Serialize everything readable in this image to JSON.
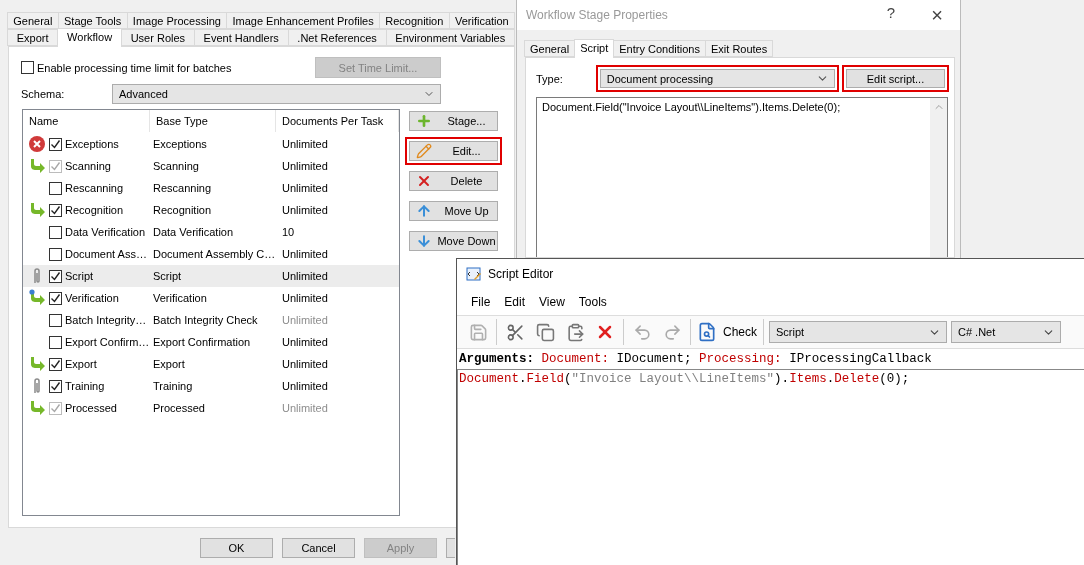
{
  "main_dialog": {
    "tabs": [
      [
        {
          "label": "General",
          "selected": false
        },
        {
          "label": "Stage Tools",
          "selected": false
        },
        {
          "label": "Image Processing",
          "selected": false
        },
        {
          "label": "Image Enhancement Profiles",
          "selected": false
        },
        {
          "label": "Recognition",
          "selected": false
        },
        {
          "label": "Verification",
          "selected": false
        }
      ],
      [
        {
          "label": "Export",
          "selected": false
        },
        {
          "label": "Workflow",
          "selected": true
        },
        {
          "label": "User Roles",
          "selected": false
        },
        {
          "label": "Event Handlers",
          "selected": false
        },
        {
          "label": ".Net References",
          "selected": false
        },
        {
          "label": "Environment Variables",
          "selected": false
        }
      ]
    ],
    "time_limit": {
      "label": "Enable processing time limit for batches",
      "checked": false
    },
    "set_time_limit": {
      "label": "Set Time Limit...",
      "disabled": true
    },
    "schema": {
      "label": "Schema:",
      "value": "Advanced"
    },
    "columns": [
      "Name",
      "Base Type",
      "Documents Per Task"
    ],
    "stages": [
      {
        "kind": "error",
        "name": "Exceptions",
        "base_type": "Exceptions",
        "docs": "Unlimited",
        "checked": true,
        "check_disabled": false,
        "docs_disabled": false,
        "selected": false
      },
      {
        "kind": "route",
        "name": "Scanning",
        "base_type": "Scanning",
        "docs": "Unlimited",
        "checked": true,
        "check_disabled": true,
        "docs_disabled": false,
        "selected": false
      },
      {
        "kind": "plain",
        "name": "Rescanning",
        "base_type": "Rescanning",
        "docs": "Unlimited",
        "checked": false,
        "check_disabled": false,
        "docs_disabled": false,
        "selected": false
      },
      {
        "kind": "route",
        "name": "Recognition",
        "base_type": "Recognition",
        "docs": "Unlimited",
        "checked": true,
        "check_disabled": false,
        "docs_disabled": false,
        "selected": false
      },
      {
        "kind": "plain",
        "name": "Data Verification",
        "base_type": "Data Verification",
        "docs": "10",
        "checked": false,
        "check_disabled": false,
        "docs_disabled": false,
        "selected": false
      },
      {
        "kind": "plain",
        "name": "Document Ass…",
        "base_type": "Document Assembly C…",
        "docs": "Unlimited",
        "checked": false,
        "check_disabled": false,
        "docs_disabled": false,
        "selected": false
      },
      {
        "kind": "script",
        "name": "Script",
        "base_type": "Script",
        "docs": "Unlimited",
        "checked": true,
        "check_disabled": false,
        "docs_disabled": false,
        "selected": true
      },
      {
        "kind": "manual",
        "name": "Verification",
        "base_type": "Verification",
        "docs": "Unlimited",
        "checked": true,
        "check_disabled": false,
        "docs_disabled": false,
        "selected": false
      },
      {
        "kind": "plain",
        "name": "Batch Integrity…",
        "base_type": "Batch Integrity Check",
        "docs": "Unlimited",
        "checked": false,
        "check_disabled": false,
        "docs_disabled": true,
        "selected": false
      },
      {
        "kind": "plain",
        "name": "Export Confirm…",
        "base_type": "Export Confirmation",
        "docs": "Unlimited",
        "checked": false,
        "check_disabled": false,
        "docs_disabled": false,
        "selected": false
      },
      {
        "kind": "route",
        "name": "Export",
        "base_type": "Export",
        "docs": "Unlimited",
        "checked": true,
        "check_disabled": false,
        "docs_disabled": false,
        "selected": false
      },
      {
        "kind": "script",
        "name": "Training",
        "base_type": "Training",
        "docs": "Unlimited",
        "checked": true,
        "check_disabled": false,
        "docs_disabled": false,
        "selected": false
      },
      {
        "kind": "route",
        "name": "Processed",
        "base_type": "Processed",
        "docs": "Unlimited",
        "checked": true,
        "check_disabled": true,
        "docs_disabled": true,
        "selected": false
      }
    ],
    "side_buttons": [
      {
        "kind": "add",
        "label": "Stage...",
        "highlighted": false
      },
      {
        "kind": "edit",
        "label": "Edit...",
        "highlighted": true
      },
      {
        "kind": "delete",
        "label": "Delete",
        "highlighted": false
      },
      {
        "kind": "up",
        "label": "Move Up",
        "highlighted": false
      },
      {
        "kind": "down",
        "label": "Move Down",
        "highlighted": false
      }
    ],
    "buttons": [
      {
        "label": "OK",
        "disabled": false
      },
      {
        "label": "Cancel",
        "disabled": false
      },
      {
        "label": "Apply",
        "disabled": true
      }
    ]
  },
  "stage_properties": {
    "title": "Workflow Stage Properties",
    "help": "?",
    "close": "×",
    "tabs": [
      {
        "label": "General",
        "selected": false
      },
      {
        "label": "Script",
        "selected": true
      },
      {
        "label": "Entry Conditions",
        "selected": false
      },
      {
        "label": "Exit Routes",
        "selected": false
      }
    ],
    "type": {
      "label": "Type:",
      "value": "Document processing",
      "highlighted": true
    },
    "edit_script": {
      "label": "Edit script...",
      "highlighted": true
    },
    "code": "Document.Field(\"Invoice Layout\\\\LineItems\").Items.Delete(0);"
  },
  "script_editor": {
    "title": "Script Editor",
    "menu": [
      "File",
      "Edit",
      "View",
      "Tools"
    ],
    "check": "Check",
    "script_select": "Script",
    "language_select": "C# .Net",
    "arguments": [
      {
        "kind": "label",
        "text": "Arguments:"
      },
      {
        "kind": "name",
        "text": "Document:"
      },
      {
        "kind": "type",
        "text": "IDocument;"
      },
      {
        "kind": "name",
        "text": "Processing:"
      },
      {
        "kind": "type",
        "text": "IProcessingCallback"
      }
    ],
    "code": [
      {
        "kind": "member",
        "text": "Document"
      },
      {
        "kind": "punct",
        "text": "."
      },
      {
        "kind": "member",
        "text": "Field"
      },
      {
        "kind": "punct",
        "text": "("
      },
      {
        "kind": "string",
        "text": "\"Invoice Layout\\\\LineItems\""
      },
      {
        "kind": "punct",
        "text": ")."
      },
      {
        "kind": "member",
        "text": "Items"
      },
      {
        "kind": "punct",
        "text": "."
      },
      {
        "kind": "member",
        "text": "Delete"
      },
      {
        "kind": "punct",
        "text": "(0);"
      }
    ]
  }
}
